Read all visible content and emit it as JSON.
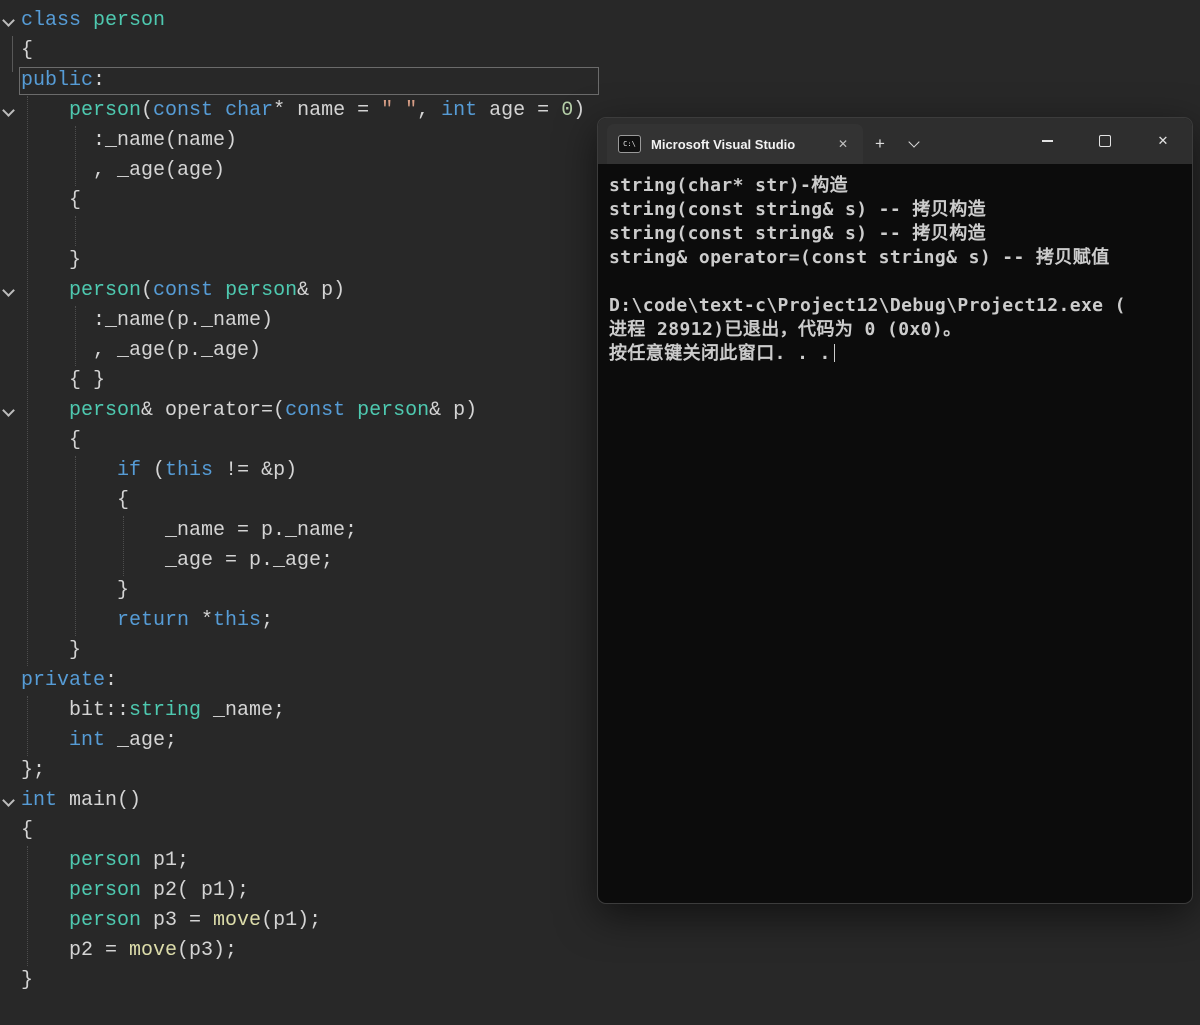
{
  "editor": {
    "colors": {
      "background": "#282828",
      "keyword": "#569cd6",
      "type": "#4ec9b0",
      "default_text": "#d4d4d4",
      "string": "#d69d85",
      "number": "#b5cea8",
      "function": "#dcdcaa"
    },
    "code_lines": [
      {
        "fold": true,
        "tokens": [
          [
            "k",
            "class"
          ],
          [
            "d",
            " "
          ],
          [
            "t",
            "person"
          ]
        ]
      },
      {
        "tokens": [
          [
            "d",
            "{"
          ]
        ]
      },
      {
        "tokens": [
          [
            "k",
            "public"
          ],
          [
            "d",
            ":"
          ]
        ]
      },
      {
        "fold": true,
        "tokens": [
          [
            "d",
            "    "
          ],
          [
            "t",
            "person"
          ],
          [
            "d",
            "("
          ],
          [
            "k",
            "const"
          ],
          [
            "d",
            " "
          ],
          [
            "k",
            "char"
          ],
          [
            "d",
            "* name = "
          ],
          [
            "s",
            "\" \""
          ],
          [
            "d",
            ", "
          ],
          [
            "k",
            "int"
          ],
          [
            "d",
            " age = "
          ],
          [
            "n",
            "0"
          ],
          [
            "d",
            ")"
          ]
        ]
      },
      {
        "tokens": [
          [
            "d",
            "      :_name(name)"
          ]
        ]
      },
      {
        "tokens": [
          [
            "d",
            "      , _age(age)"
          ]
        ]
      },
      {
        "tokens": [
          [
            "d",
            "    {"
          ]
        ]
      },
      {
        "tokens": [
          [
            "d",
            ""
          ]
        ]
      },
      {
        "tokens": [
          [
            "d",
            "    }"
          ]
        ]
      },
      {
        "fold": true,
        "tokens": [
          [
            "d",
            "    "
          ],
          [
            "t",
            "person"
          ],
          [
            "d",
            "("
          ],
          [
            "k",
            "const"
          ],
          [
            "d",
            " "
          ],
          [
            "t",
            "person"
          ],
          [
            "d",
            "& p)"
          ]
        ]
      },
      {
        "tokens": [
          [
            "d",
            "      :_name(p._name)"
          ]
        ]
      },
      {
        "tokens": [
          [
            "d",
            "      , _age(p._age)"
          ]
        ]
      },
      {
        "tokens": [
          [
            "d",
            "    { }"
          ]
        ]
      },
      {
        "fold": true,
        "tokens": [
          [
            "d",
            "    "
          ],
          [
            "t",
            "person"
          ],
          [
            "d",
            "& operator=("
          ],
          [
            "k",
            "const"
          ],
          [
            "d",
            " "
          ],
          [
            "t",
            "person"
          ],
          [
            "d",
            "& p)"
          ]
        ]
      },
      {
        "tokens": [
          [
            "d",
            "    {"
          ]
        ]
      },
      {
        "tokens": [
          [
            "d",
            "        "
          ],
          [
            "k",
            "if"
          ],
          [
            "d",
            " ("
          ],
          [
            "k",
            "this"
          ],
          [
            "d",
            " != &p)"
          ]
        ]
      },
      {
        "tokens": [
          [
            "d",
            "        {"
          ]
        ]
      },
      {
        "tokens": [
          [
            "d",
            "            _name = p._name;"
          ]
        ]
      },
      {
        "tokens": [
          [
            "d",
            "            _age = p._age;"
          ]
        ]
      },
      {
        "tokens": [
          [
            "d",
            "        }"
          ]
        ]
      },
      {
        "tokens": [
          [
            "d",
            "        "
          ],
          [
            "k",
            "return"
          ],
          [
            "d",
            " *"
          ],
          [
            "k",
            "this"
          ],
          [
            "d",
            ";"
          ]
        ]
      },
      {
        "tokens": [
          [
            "d",
            "    }"
          ]
        ]
      },
      {
        "tokens": [
          [
            "k",
            "private"
          ],
          [
            "d",
            ":"
          ]
        ]
      },
      {
        "tokens": [
          [
            "d",
            "    bit::"
          ],
          [
            "t",
            "string"
          ],
          [
            "d",
            " _name;"
          ]
        ]
      },
      {
        "tokens": [
          [
            "d",
            "    "
          ],
          [
            "k",
            "int"
          ],
          [
            "d",
            " _age;"
          ]
        ]
      },
      {
        "tokens": [
          [
            "d",
            "};"
          ]
        ]
      },
      {
        "fold": true,
        "tokens": [
          [
            "k",
            "int"
          ],
          [
            "d",
            " main()"
          ]
        ]
      },
      {
        "tokens": [
          [
            "d",
            "{"
          ]
        ]
      },
      {
        "tokens": [
          [
            "d",
            "    "
          ],
          [
            "t",
            "person"
          ],
          [
            "d",
            " p1;"
          ]
        ]
      },
      {
        "tokens": [
          [
            "d",
            "    "
          ],
          [
            "t",
            "person"
          ],
          [
            "d",
            " p2( p1);"
          ]
        ]
      },
      {
        "tokens": [
          [
            "d",
            "    "
          ],
          [
            "t",
            "person"
          ],
          [
            "d",
            " p3 = "
          ],
          [
            "f",
            "move"
          ],
          [
            "d",
            "(p1);"
          ]
        ]
      },
      {
        "tokens": [
          [
            "d",
            "    p2 = "
          ],
          [
            "f",
            "move"
          ],
          [
            "d",
            "(p3);"
          ]
        ]
      },
      {
        "tokens": [
          [
            "d",
            "}"
          ]
        ]
      }
    ]
  },
  "terminal": {
    "tab_title": "Microsoft Visual Studio",
    "icon_text": "C:\\",
    "tab_close_label": "✕",
    "new_tab_label": "+",
    "close_label": "✕",
    "colors": {
      "body_background": "#0c0c0c",
      "titlebar_background": "#2e2e2e",
      "text": "#cccccc"
    },
    "lines": [
      "string(char* str)-构造",
      "string(const string& s) -- 拷贝构造",
      "string(const string& s) -- 拷贝构造",
      "string& operator=(const string& s) -- 拷贝赋值",
      "",
      "D:\\code\\text-c\\Project12\\Debug\\Project12.exe (",
      "进程 28912)已退出，代码为 0 (0x0)。",
      "按任意键关闭此窗口. . ."
    ]
  }
}
